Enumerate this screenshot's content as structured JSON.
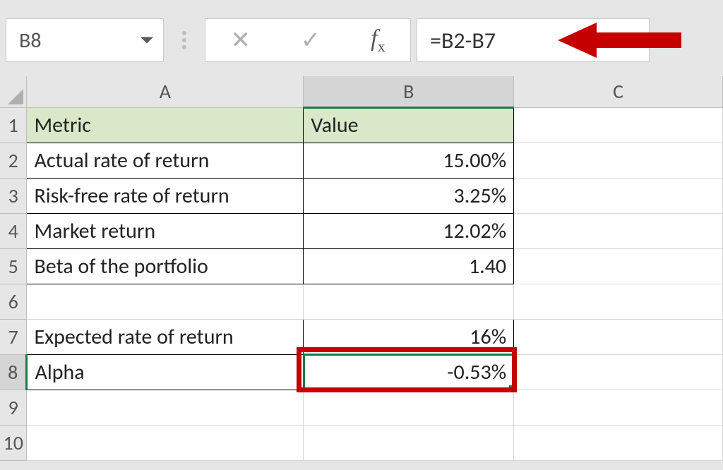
{
  "formula_bar": {
    "name_box": "B8",
    "formula": "=B2-B7",
    "cancel_icon": "✕",
    "enter_icon": "✓",
    "fx_label": "fx"
  },
  "columns": [
    "A",
    "B",
    "C"
  ],
  "row_numbers": [
    "1",
    "2",
    "3",
    "4",
    "5",
    "6",
    "7",
    "8",
    "9",
    "10"
  ],
  "headers": {
    "A": "Metric",
    "B": "Value"
  },
  "rows": {
    "2": {
      "A": "Actual rate of return",
      "B": "15.00%"
    },
    "3": {
      "A": "Risk-free rate of return",
      "B": "3.25%"
    },
    "4": {
      "A": "Market return",
      "B": "12.02%"
    },
    "5": {
      "A": "Beta of the portfolio",
      "B": "1.40"
    },
    "6": {
      "A": "",
      "B": ""
    },
    "7": {
      "A": "Expected rate of return",
      "B": "16%"
    },
    "8": {
      "A": "Alpha",
      "B": "-0.53%"
    }
  },
  "selection": {
    "cell": "B8",
    "row": 8,
    "col": "B"
  },
  "annotations": {
    "redbox_target": "B8",
    "arrow_target": "formula"
  },
  "colors": {
    "accent": "#1a7a43",
    "annotation": "#c40000",
    "header_fill": "#d8e8c8"
  }
}
